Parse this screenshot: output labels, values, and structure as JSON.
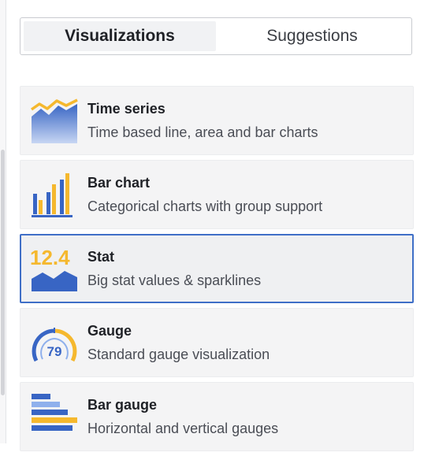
{
  "tabs": [
    {
      "label": "Visualizations",
      "active": true
    },
    {
      "label": "Suggestions",
      "active": false
    }
  ],
  "visualizations": [
    {
      "title": "Time series",
      "description": "Time based line, area and bar charts",
      "icon": "time-series-icon",
      "selected": false
    },
    {
      "title": "Bar chart",
      "description": "Categorical charts with group support",
      "icon": "bar-chart-icon",
      "selected": false
    },
    {
      "title": "Stat",
      "description": "Big stat values & sparklines",
      "icon": "stat-icon",
      "icon_text": "12.4",
      "selected": true
    },
    {
      "title": "Gauge",
      "description": "Standard gauge visualization",
      "icon": "gauge-icon",
      "icon_text": "79",
      "selected": false
    },
    {
      "title": "Bar gauge",
      "description": "Horizontal and vertical gauges",
      "icon": "bar-gauge-icon",
      "selected": false
    }
  ],
  "colors": {
    "accent_blue": "#3f6fc7",
    "icon_orange": "#f5b82e",
    "icon_blue": "#3865c4",
    "icon_light_blue": "#8fb0ec"
  }
}
